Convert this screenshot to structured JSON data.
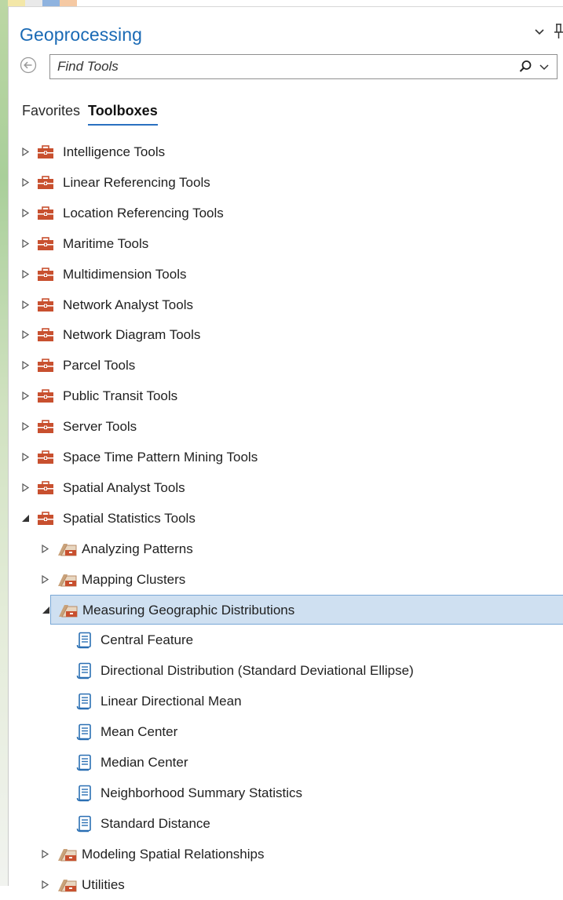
{
  "panel": {
    "title": "Geoprocessing"
  },
  "search": {
    "placeholder": "Find Tools"
  },
  "tabs": [
    {
      "label": "Favorites",
      "active": false
    },
    {
      "label": "Toolboxes",
      "active": true
    }
  ],
  "icons": {
    "toolbox": "toolbox-icon",
    "toolset": "toolset-icon",
    "tool": "script-tool-icon",
    "collapsed": "triangle-right-icon",
    "expanded": "triangle-down-icon"
  },
  "colors": {
    "accent": "#1a6ab5",
    "toolbox": "#c8502f",
    "selection": "#cfe0f1"
  },
  "tree": {
    "toolboxes": [
      {
        "label": "Intelligence Tools",
        "state": "collapsed"
      },
      {
        "label": "Linear Referencing Tools",
        "state": "collapsed"
      },
      {
        "label": "Location Referencing Tools",
        "state": "collapsed"
      },
      {
        "label": "Maritime Tools",
        "state": "collapsed"
      },
      {
        "label": "Multidimension Tools",
        "state": "collapsed"
      },
      {
        "label": "Network Analyst Tools",
        "state": "collapsed"
      },
      {
        "label": "Network Diagram Tools",
        "state": "collapsed"
      },
      {
        "label": "Parcel Tools",
        "state": "collapsed"
      },
      {
        "label": "Public Transit Tools",
        "state": "collapsed"
      },
      {
        "label": "Server Tools",
        "state": "collapsed"
      },
      {
        "label": "Space Time Pattern Mining Tools",
        "state": "collapsed"
      },
      {
        "label": "Spatial Analyst Tools",
        "state": "collapsed"
      },
      {
        "label": "Spatial Statistics Tools",
        "state": "expanded"
      }
    ],
    "toolsets": [
      {
        "label": "Analyzing Patterns",
        "state": "collapsed"
      },
      {
        "label": "Mapping Clusters",
        "state": "collapsed"
      },
      {
        "label": "Measuring Geographic Distributions",
        "state": "expanded",
        "selected": true
      }
    ],
    "tools": [
      {
        "label": "Central Feature"
      },
      {
        "label": "Directional Distribution (Standard Deviational Ellipse)"
      },
      {
        "label": "Linear Directional Mean"
      },
      {
        "label": "Mean Center"
      },
      {
        "label": "Median Center"
      },
      {
        "label": "Neighborhood Summary Statistics"
      },
      {
        "label": "Standard Distance"
      }
    ],
    "toolsets_after": [
      {
        "label": "Modeling Spatial Relationships",
        "state": "collapsed"
      },
      {
        "label": "Utilities",
        "state": "collapsed"
      }
    ]
  }
}
